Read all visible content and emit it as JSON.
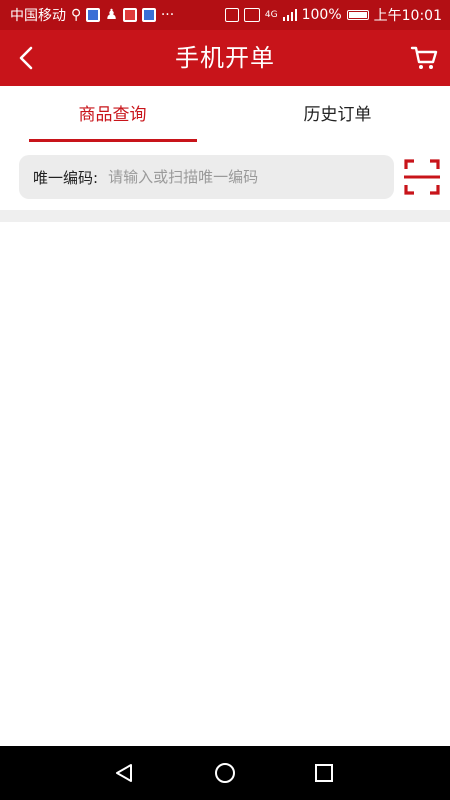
{
  "status_bar": {
    "carrier": "中国移动",
    "overflow": "···",
    "network": "4G",
    "battery": "100%",
    "time": "上午10:01"
  },
  "app_bar": {
    "title": "手机开单",
    "back_icon": "chevron-left-icon",
    "cart_icon": "shopping-cart-icon"
  },
  "tabs": [
    {
      "label": "商品查询",
      "active": true
    },
    {
      "label": "历史订单",
      "active": false
    }
  ],
  "search": {
    "label": "唯一编码:",
    "value": "",
    "placeholder": "请输入或扫描唯一编码",
    "scan_icon": "scan-icon"
  },
  "colors": {
    "primary": "#c8141a",
    "status_bar": "#b30f14",
    "search_bg": "#ececec",
    "divider": "#efefef"
  },
  "nav_bar": {
    "icons": [
      "back-triangle-icon",
      "home-circle-icon",
      "recents-square-icon"
    ]
  }
}
